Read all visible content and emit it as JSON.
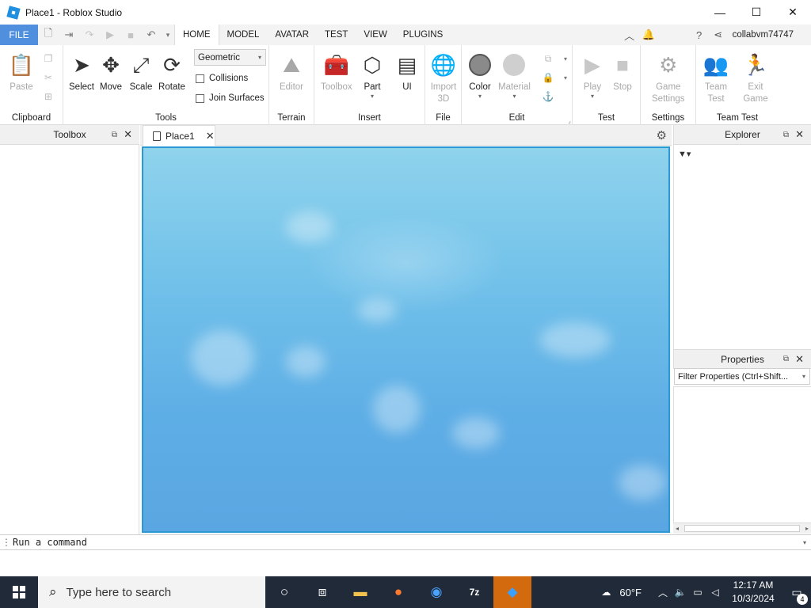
{
  "window": {
    "title": "Place1 - Roblox Studio",
    "minimize": "—",
    "maximize": "☐",
    "close": "✕"
  },
  "menu": {
    "file": "FILE",
    "tabs": [
      "HOME",
      "MODEL",
      "AVATAR",
      "TEST",
      "VIEW",
      "PLUGINS"
    ],
    "active_tab": "HOME",
    "username": "collabvm74747"
  },
  "ribbon": {
    "clipboard": {
      "paste": "Paste",
      "group": "Clipboard"
    },
    "tools": {
      "select": "Select",
      "move": "Move",
      "scale": "Scale",
      "rotate": "Rotate",
      "group": "Tools",
      "mode": "Geometric",
      "collisions": "Collisions",
      "join_surfaces": "Join Surfaces"
    },
    "terrain": {
      "editor": "Editor",
      "group": "Terrain"
    },
    "insert": {
      "toolbox": "Toolbox",
      "part": "Part",
      "ui": "UI",
      "group": "Insert"
    },
    "file": {
      "import_line1": "Import",
      "import_line2": "3D",
      "group": "File"
    },
    "edit": {
      "color": "Color",
      "material": "Material",
      "group": "Edit"
    },
    "test": {
      "play": "Play",
      "stop": "Stop",
      "group": "Test"
    },
    "settings": {
      "game_line1": "Game",
      "game_line2": "Settings",
      "group": "Settings"
    },
    "team_test": {
      "team_line1": "Team",
      "team_line2": "Test",
      "exit_line1": "Exit",
      "exit_line2": "Game",
      "group": "Team Test"
    }
  },
  "panels": {
    "toolbox": {
      "title": "Toolbox"
    },
    "doc_tab": {
      "label": "Place1"
    },
    "explorer": {
      "title": "Explorer"
    },
    "properties": {
      "title": "Properties",
      "filter_placeholder": "Filter Properties (Ctrl+Shift..."
    }
  },
  "command_bar": {
    "placeholder": "Run a command"
  },
  "taskbar": {
    "search_placeholder": "Type here to search",
    "weather": "60°F",
    "time": "12:17 AM",
    "date": "10/3/2024",
    "notifications": "4",
    "accent": "#d46a0e"
  }
}
